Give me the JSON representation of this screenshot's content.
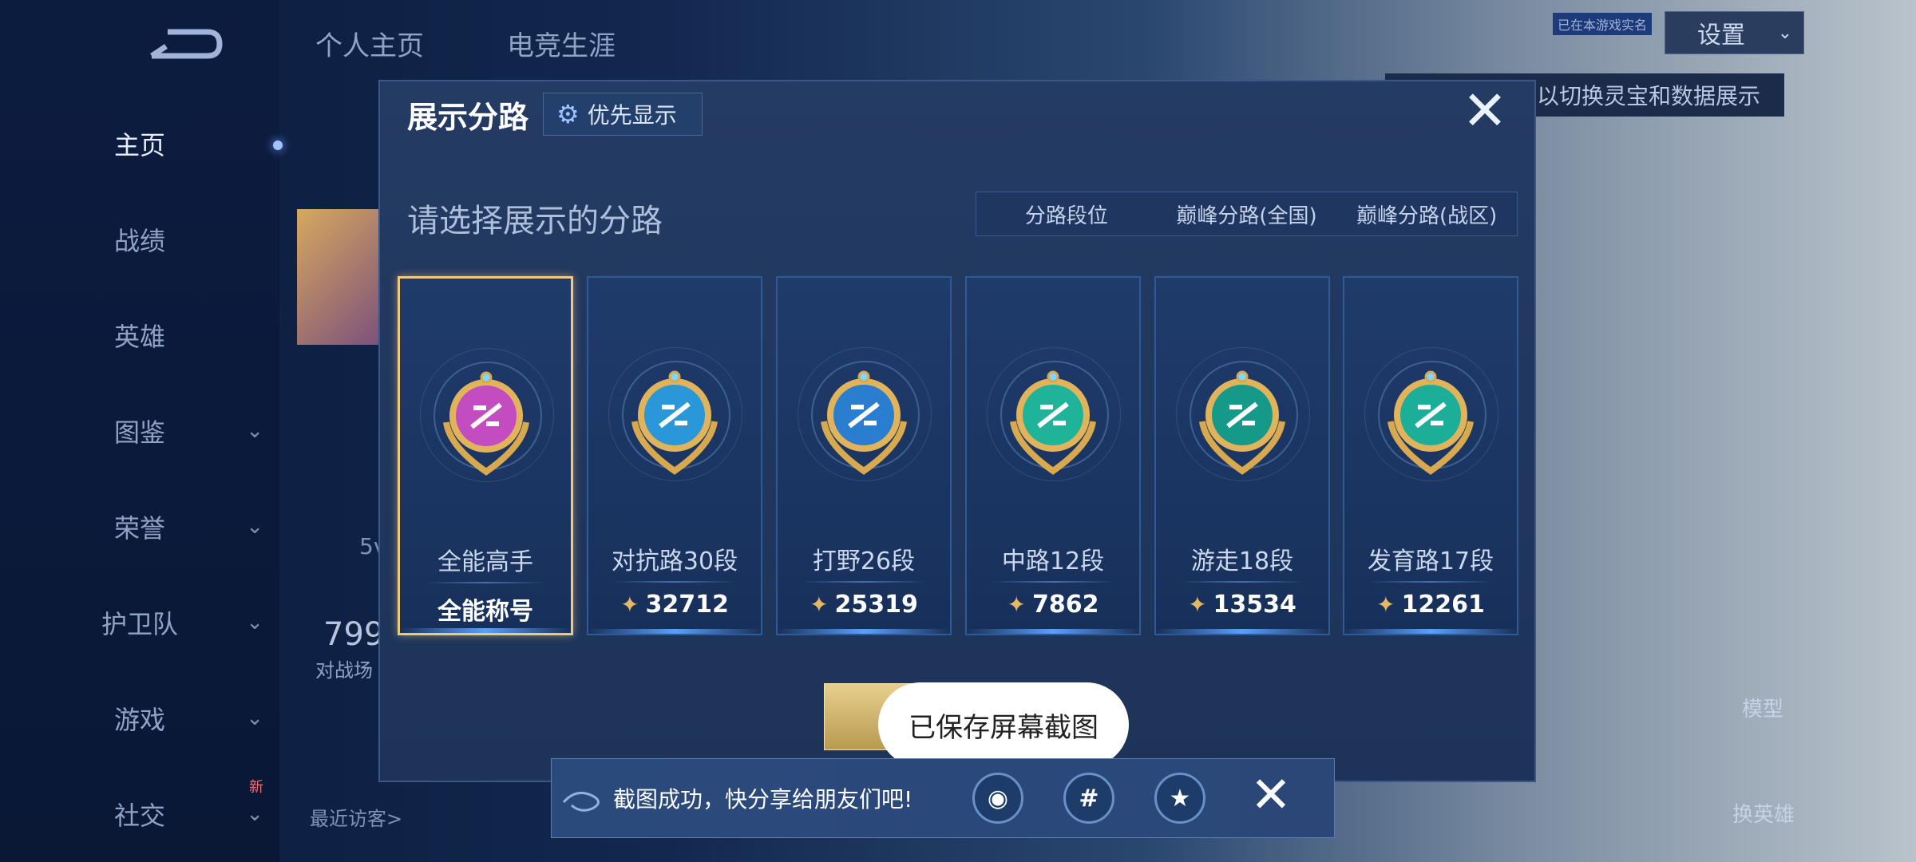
{
  "left_nav": {
    "items": [
      {
        "label": "主页",
        "has_chevron": false,
        "active": true
      },
      {
        "label": "战绩",
        "has_chevron": false
      },
      {
        "label": "英雄",
        "has_chevron": false
      },
      {
        "label": "图鉴",
        "has_chevron": true
      },
      {
        "label": "荣誉",
        "has_chevron": true
      },
      {
        "label": "护卫队",
        "has_chevron": true
      },
      {
        "label": "游戏",
        "has_chevron": true
      },
      {
        "label": "社交",
        "has_chevron": true
      }
    ],
    "new_badge": "新"
  },
  "top_tabs": {
    "personal": "个人主页",
    "career": "电竞生涯"
  },
  "settings": {
    "label": "设置",
    "small_tag": "已在本游戏实名"
  },
  "background": {
    "hint": "以切换灵宝和数据展示",
    "recent_visitors": "最近访客>",
    "stat_value": "799",
    "stat_label": "对战场",
    "small_text": "5v",
    "model_btn": "模型",
    "change_hero_btn": "换英雄"
  },
  "modal": {
    "title": "展示分路",
    "priority_btn": "优先显示",
    "subtitle": "请选择展示的分路",
    "tabs": [
      {
        "label": "分路段位",
        "active": true
      },
      {
        "label": "巅峰分路(全国)",
        "active": false
      },
      {
        "label": "巅峰分路(战区)",
        "active": false
      }
    ],
    "cards": [
      {
        "lane": "全能高手",
        "score": "全能称号",
        "badge_color": "#c24cc0",
        "selected": true,
        "score_icon": false
      },
      {
        "lane": "对抗路30段",
        "score": "32712",
        "badge_color": "#2a98d8",
        "selected": false,
        "score_icon": true
      },
      {
        "lane": "打野26段",
        "score": "25319",
        "badge_color": "#2a7ed0",
        "selected": false,
        "score_icon": true
      },
      {
        "lane": "中路12段",
        "score": "7862",
        "badge_color": "#1fb39a",
        "selected": false,
        "score_icon": true
      },
      {
        "lane": "游走18段",
        "score": "13534",
        "badge_color": "#159a8a",
        "selected": false,
        "score_icon": true
      },
      {
        "lane": "发育路17段",
        "score": "12261",
        "badge_color": "#1cae98",
        "selected": false,
        "score_icon": true
      }
    ]
  },
  "toast": {
    "text": "已保存屏幕截图"
  },
  "share": {
    "text": "截图成功，快分享给朋友们吧!",
    "icons": [
      "qq-icon",
      "wechat-moments-icon",
      "qzone-icon"
    ],
    "icon_glyphs": [
      "◉",
      "#",
      "★"
    ]
  }
}
